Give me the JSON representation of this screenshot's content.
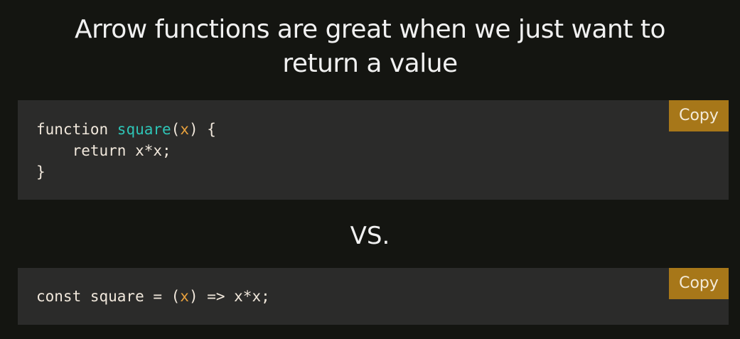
{
  "title": {
    "line1": "Arrow functions are great when we just want to",
    "line2": "return a value"
  },
  "colors": {
    "background": "#141511",
    "code_background": "#2b2b2a",
    "copy_button": "#a77719",
    "function_name": "#2ec4b6",
    "parameter": "#e8a13d",
    "code_text": "#f1e8dc"
  },
  "code_block_1": {
    "copy_label": "Copy",
    "line1": {
      "keyword": "function ",
      "name": "square",
      "open_paren": "(",
      "param": "x",
      "rest": ") {"
    },
    "line2": "    return x*x;",
    "line3": "}"
  },
  "separator": "VS.",
  "code_block_2": {
    "copy_label": "Copy",
    "line1": {
      "prefix": "const square = (",
      "param": "x",
      "rest": ") => x*x;"
    }
  }
}
